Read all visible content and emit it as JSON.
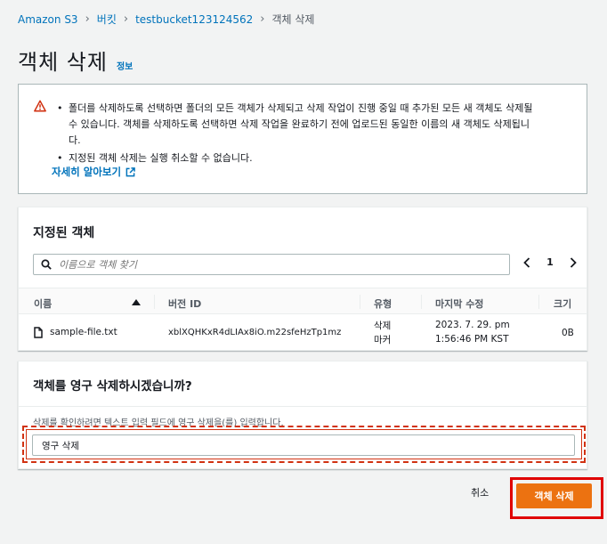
{
  "breadcrumb": [
    "Amazon S3",
    "버킷",
    "testbucket123124562",
    "객체 삭제"
  ],
  "page": {
    "title": "객체 삭제",
    "info_link": "정보"
  },
  "warning": {
    "bullet1_line1": "폴더를 삭제하도록 선택하면 폴더의 모든 객체가 삭제되고 삭제 작업이 진행 중일 때 추가된 모든 새 객체도 삭제될",
    "bullet1_line2": "수 있습니다. 객체를 삭제하도록 선택하면 삭제 작업을 완료하기 전에 업로드된 동일한 이름의 새 객체도 삭제됩니",
    "bullet1_line3": "다.",
    "bullet2": "지정된 객체 삭제는 실행 취소할 수 없습니다.",
    "learn_more": "자세히 알아보기"
  },
  "objects": {
    "title": "지정된 객체",
    "search_placeholder": "이름으로 객체 찾기",
    "page_number": "1",
    "columns": [
      "이름",
      "버전 ID",
      "유형",
      "마지막 수정",
      "크기"
    ],
    "row": {
      "name": "sample-file.txt",
      "version_id": "xblXQHKxR4dLIAx8iO.m22sfeHzTp1mz",
      "type_line1": "삭제",
      "type_line2": "마커",
      "modified_line1": "2023. 7. 29. pm",
      "modified_line2": "1:56:46 PM KST",
      "size": "0B"
    }
  },
  "confirm": {
    "title": "객체를 영구 삭제하시겠습니까?",
    "hint": "삭제를 확인하려면 텍스트 입력 필드에 영구 삭제을(를) 입력합니다.",
    "input_value": "영구 삭제"
  },
  "buttons": {
    "cancel": "취소",
    "delete": "객체 삭제"
  },
  "colors": {
    "link": "#0073bb",
    "primary": "#ec7211",
    "highlight": "#e00000",
    "warning": "#d13212"
  }
}
